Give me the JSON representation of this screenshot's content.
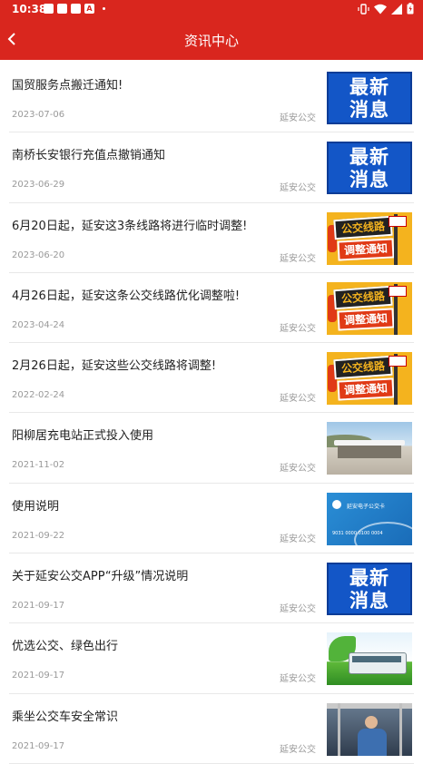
{
  "statusbar": {
    "time": "10:38",
    "a_glyph": "A"
  },
  "header": {
    "title": "资讯中心"
  },
  "news": [
    {
      "title": "国贸服务点搬迁通知!",
      "date": "2023-07-06",
      "source": "延安公交",
      "thumb": "news"
    },
    {
      "title": "南桥长安银行充值点撤销通知",
      "date": "2023-06-29",
      "source": "延安公交",
      "thumb": "news"
    },
    {
      "title": "6月20日起，延安这3条线路将进行临时调整!",
      "date": "2023-06-20",
      "source": "延安公交",
      "thumb": "route"
    },
    {
      "title": "4月26日起，延安这条公交线路优化调整啦!",
      "date": "2023-04-24",
      "source": "延安公交",
      "thumb": "route"
    },
    {
      "title": "2月26日起，延安这些公交线路将调整!",
      "date": "2022-02-24",
      "source": "延安公交",
      "thumb": "route"
    },
    {
      "title": "阳柳居充电站正式投入使用",
      "date": "2021-11-02",
      "source": "延安公交",
      "thumb": "station"
    },
    {
      "title": "使用说明",
      "date": "2021-09-22",
      "source": "延安公交",
      "thumb": "card"
    },
    {
      "title": "关于延安公交APP“升级”情况说明",
      "date": "2021-09-17",
      "source": "延安公交",
      "thumb": "news"
    },
    {
      "title": "优选公交、绿色出行",
      "date": "2021-09-17",
      "source": "延安公交",
      "thumb": "green"
    },
    {
      "title": "乘坐公交车安全常识",
      "date": "2021-09-17",
      "source": "延安公交",
      "thumb": "bus"
    }
  ],
  "thumb_text": {
    "news_line1": "最新",
    "news_line2": "消息",
    "route_line1": "公交线路",
    "route_line2": "调整通知",
    "card_name": "延安电子公交卡",
    "card_number": "9031 0000 0100 0004"
  },
  "colors": {
    "header": "#d9261e",
    "news_thumb": "#1356c7",
    "route_thumb": "#f4b31e"
  }
}
